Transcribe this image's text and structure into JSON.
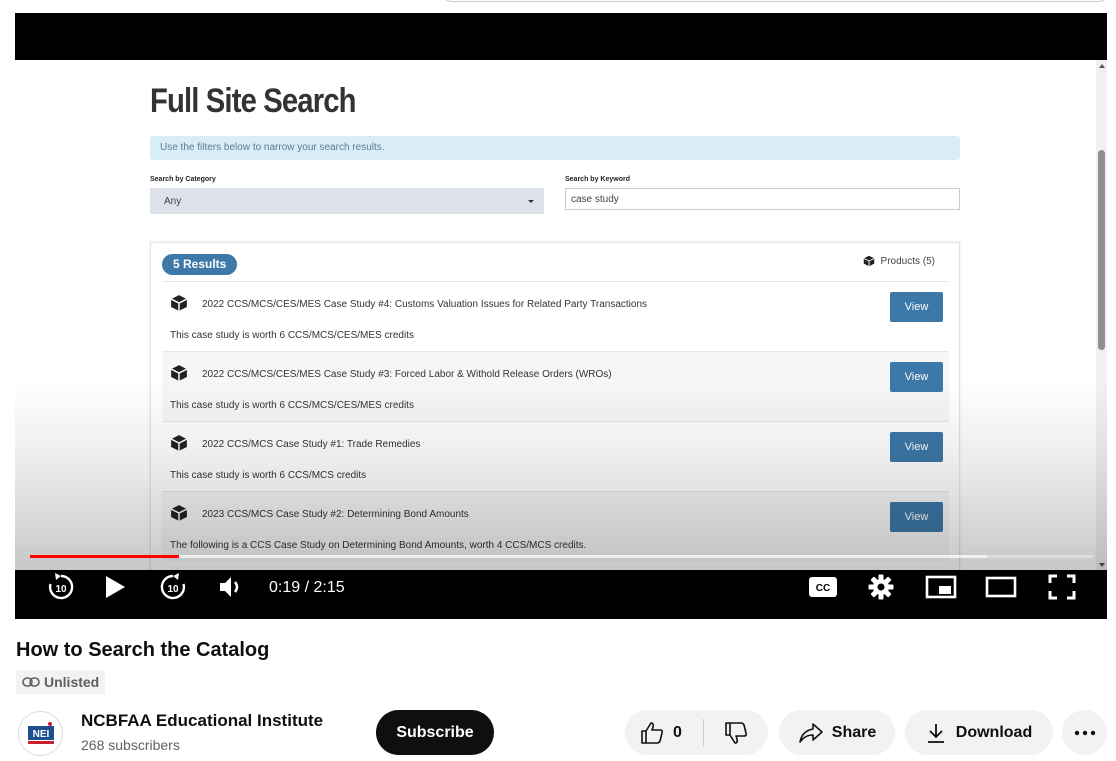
{
  "video_content": {
    "page_title": "Full Site Search",
    "notice": "Use the filters below to narrow your search results.",
    "category_label": "Search by Category",
    "category_value": "Any",
    "keyword_label": "Search by Keyword",
    "keyword_value": "case study",
    "results_badge": "5 Results",
    "products_label": "Products (5)",
    "results": [
      {
        "title": "2022 CCS/MCS/CES/MES Case Study #4: Customs Valuation Issues for Related Party Transactions",
        "desc": "This case study is worth 6 CCS/MCS/CES/MES credits",
        "button": "View"
      },
      {
        "title": "2022 CCS/MCS/CES/MES Case Study #3: Forced Labor & Withold Release Orders (WROs)",
        "desc": "This case study is worth 6 CCS/MCS/CES/MES credits",
        "button": "View"
      },
      {
        "title": "2022 CCS/MCS Case Study #1: Trade Remedies",
        "desc": "This case study is worth 6 CCS/MCS credits",
        "button": "View"
      },
      {
        "title": "2023 CCS/MCS Case Study #2: Determining Bond Amounts",
        "desc": "The following is a CCS Case Study on Determining Bond Amounts, worth 4 CCS/MCS credits.",
        "button": "View"
      }
    ]
  },
  "player": {
    "time_display": "0:19 / 2:15",
    "played_fraction": 0.14,
    "loaded_fraction": 0.9,
    "rewind_label": "10",
    "forward_label": "10",
    "cc_label": "CC"
  },
  "video_info": {
    "title": "How to Search the Catalog",
    "visibility": "Unlisted",
    "channel_name": "NCBFAA Educational Institute",
    "subscribers": "268 subscribers",
    "avatar_text": "NEI",
    "subscribe_label": "Subscribe",
    "like_count": "0",
    "share_label": "Share",
    "download_label": "Download"
  },
  "colors": {
    "progress": "#ff0000",
    "view_button": "#3c78a8",
    "subscribe_bg": "#0f0f0f"
  }
}
